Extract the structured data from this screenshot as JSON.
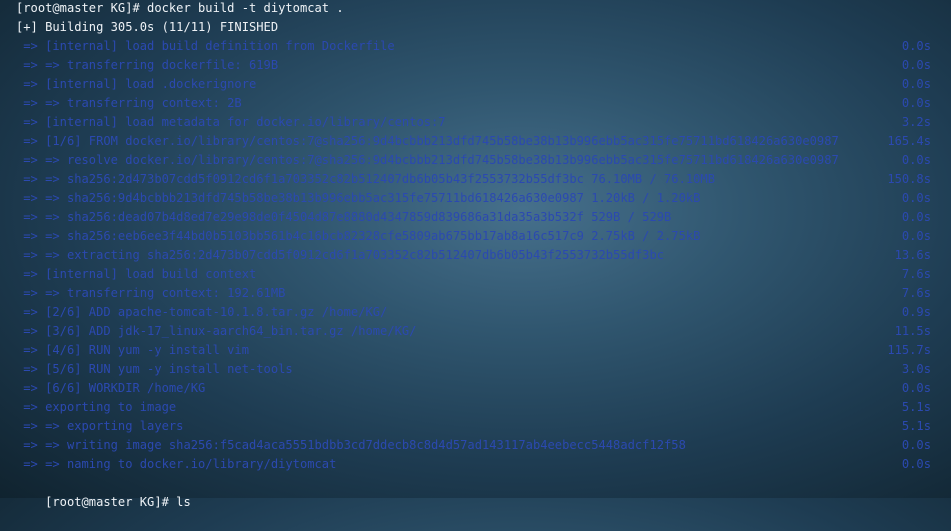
{
  "terminal": {
    "prompt1": "[root@master KG]# docker build -t diytomcat .",
    "header": "[+] Building 305.0s (11/11) FINISHED",
    "steps": [
      {
        "text": " => [internal] load build definition from Dockerfile",
        "time": "0.0s"
      },
      {
        "text": " => => transferring dockerfile: 619B",
        "time": "0.0s"
      },
      {
        "text": " => [internal] load .dockerignore",
        "time": "0.0s"
      },
      {
        "text": " => => transferring context: 2B",
        "time": "0.0s"
      },
      {
        "text": " => [internal] load metadata for docker.io/library/centos:7",
        "time": "3.2s"
      },
      {
        "text": " => [1/6] FROM docker.io/library/centos:7@sha256:9d4bcbbb213dfd745b58be38b13b996ebb5ac315fe75711bd618426a630e0987",
        "time": "165.4s"
      },
      {
        "text": " => => resolve docker.io/library/centos:7@sha256:9d4bcbbb213dfd745b58be38b13b996ebb5ac315fe75711bd618426a630e0987",
        "time": "0.0s"
      },
      {
        "text": " => => sha256:2d473b07cdd5f0912cd6f1a703352c82b512407db6b05b43f2553732b55df3bc 76.10MB / 76.10MB",
        "time": "150.8s"
      },
      {
        "text": " => => sha256:9d4bcbbb213dfd745b58be38b13b996ebb5ac315fe75711bd618426a630e0987 1.20kB / 1.20kB",
        "time": "0.0s"
      },
      {
        "text": " => => sha256:dead07b4d8ed7e29e98de0f4504d87e8880d4347859d839686a31da35a3b532f 529B / 529B",
        "time": "0.0s"
      },
      {
        "text": " => => sha256:eeb6ee3f44bd0b5103bb561b4c16bcb82328cfe5809ab675bb17ab8a16c517c9 2.75kB / 2.75kB",
        "time": "0.0s"
      },
      {
        "text": " => => extracting sha256:2d473b07cdd5f0912cd6f1a703352c82b512407db6b05b43f2553732b55df3bc",
        "time": "13.6s"
      },
      {
        "text": " => [internal] load build context",
        "time": "7.6s"
      },
      {
        "text": " => => transferring context: 192.61MB",
        "time": "7.6s"
      },
      {
        "text": " => [2/6] ADD apache-tomcat-10.1.8.tar.gz /home/KG/",
        "time": "0.9s"
      },
      {
        "text": " => [3/6] ADD jdk-17_linux-aarch64_bin.tar.gz /home/KG/",
        "time": "11.5s"
      },
      {
        "text": " => [4/6] RUN yum -y install vim",
        "time": "115.7s"
      },
      {
        "text": " => [5/6] RUN yum -y install net-tools",
        "time": "3.0s"
      },
      {
        "text": " => [6/6] WORKDIR /home/KG",
        "time": "0.0s"
      },
      {
        "text": " => exporting to image",
        "time": "5.1s"
      },
      {
        "text": " => => exporting layers",
        "time": "5.1s"
      },
      {
        "text": " => => writing image sha256:f5cad4aca5551bdbb3cd7ddecb8c8d4d57ad143117ab4eebecc5448adcf12f58",
        "time": "0.0s"
      },
      {
        "text": " => => naming to docker.io/library/diytomcat",
        "time": "0.0s"
      }
    ],
    "prompt2": "[root@master KG]# ls"
  },
  "colors": {
    "prompt_text": "#eef2f6",
    "step_text": "#2b49b0",
    "background_center": "#46708c",
    "background_edge": "#10232f"
  }
}
